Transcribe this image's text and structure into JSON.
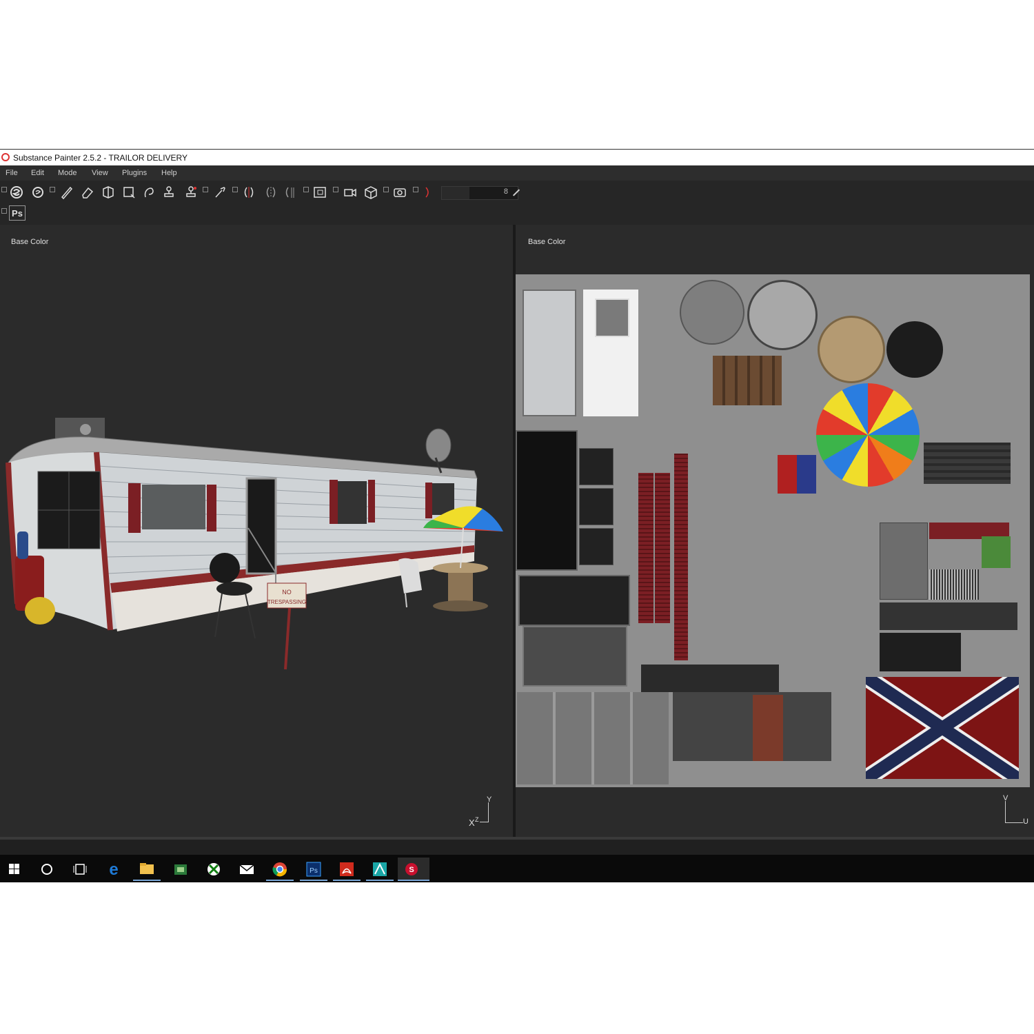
{
  "window": {
    "title": "Substance Painter 2.5.2 - TRAILOR DELIVERY"
  },
  "menu": [
    "File",
    "Edit",
    "Mode",
    "View",
    "Plugins",
    "Help"
  ],
  "toolbar": {
    "tools": [
      "brush-icon",
      "eraser-icon",
      "projection-icon",
      "polygon-fill-icon",
      "smudge-icon",
      "clone-icon",
      "material-picker-icon",
      "paint-icon",
      "symmetry-icon",
      "view-mode-icon",
      "camera-icon",
      "cube-icon",
      "screenshot-icon"
    ],
    "brush_size_value": "8",
    "photoshop_label": "Ps"
  },
  "viewport_3d": {
    "channel_label": "Base Color",
    "axis_x": "X",
    "axis_z": "Z",
    "axis_y": "Y"
  },
  "viewport_2d": {
    "channel_label": "Base Color",
    "axis_v": "V",
    "axis_u": "U"
  },
  "scene_text": {
    "sign_line1": "NO",
    "sign_line2": "TRESPASSING"
  },
  "taskbar": {
    "items": [
      "windows-start-icon",
      "search-circle-icon",
      "task-view-icon",
      "edge-icon",
      "file-explorer-icon",
      "store-icon",
      "xbox-icon",
      "mail-icon",
      "chrome-icon",
      "photoshop-icon",
      "acrobat-icon",
      "maya-icon",
      "substance-painter-icon"
    ],
    "colors": {
      "edge": "#1e7ad6",
      "explorer": "#f2c14e",
      "chrome_red": "#db4437",
      "photoshop": "#0b2f6b",
      "acrobat": "#d02b1d"
    }
  }
}
